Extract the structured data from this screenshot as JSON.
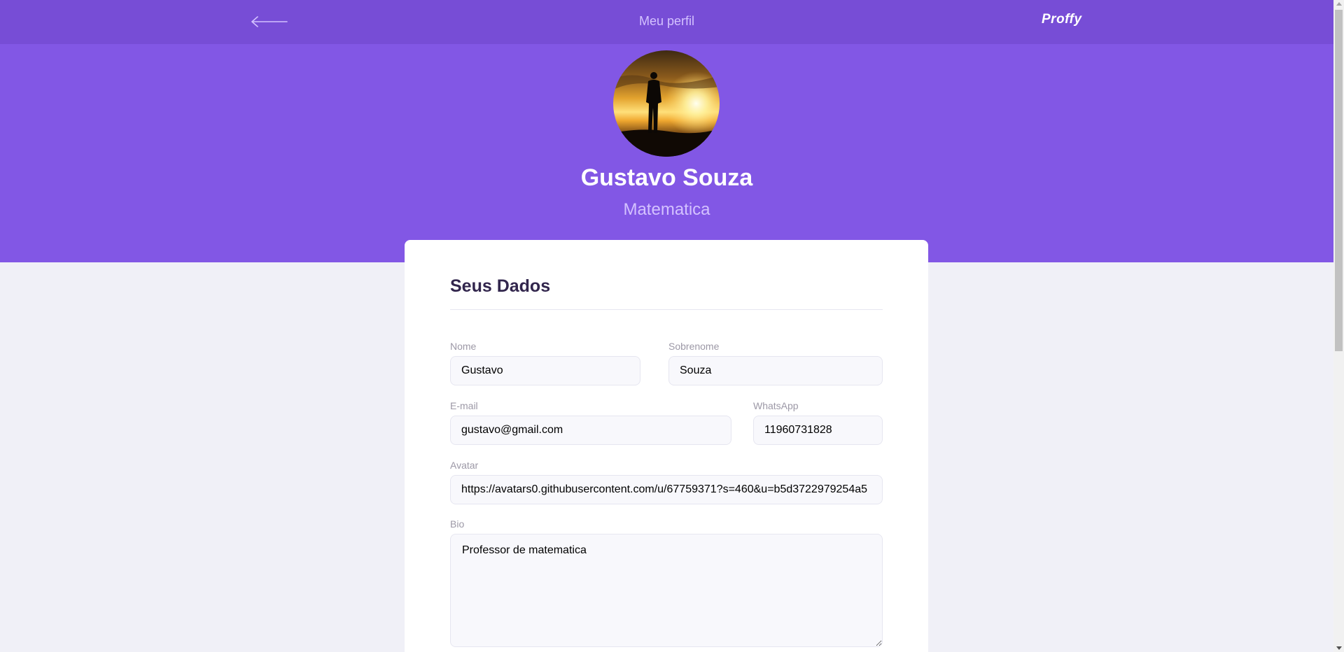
{
  "header": {
    "back_icon": "arrow-left-icon",
    "title": "Meu perfil",
    "brand": "Proffy"
  },
  "profile": {
    "avatar_icon": "sunset-silhouette-photo",
    "name": "Gustavo Souza",
    "subject": "Matematica"
  },
  "form": {
    "section_title": "Seus Dados",
    "first_name": {
      "label": "Nome",
      "value": "Gustavo"
    },
    "last_name": {
      "label": "Sobrenome",
      "value": "Souza"
    },
    "email": {
      "label": "E-mail",
      "value": "gustavo@gmail.com"
    },
    "whatsapp": {
      "label": "WhatsApp",
      "value": "11960731828"
    },
    "avatar": {
      "label": "Avatar",
      "value": "https://avatars0.githubusercontent.com/u/67759371?s=460&u=b5d3722979254a5"
    },
    "bio": {
      "label": "Bio",
      "value": "Professor de matematica"
    }
  },
  "colors": {
    "topbar": "#774DD6",
    "hero": "#8257E5",
    "page_bg": "#F0F0F7",
    "title_text": "#32264D",
    "muted_text": "#9C98A6"
  }
}
